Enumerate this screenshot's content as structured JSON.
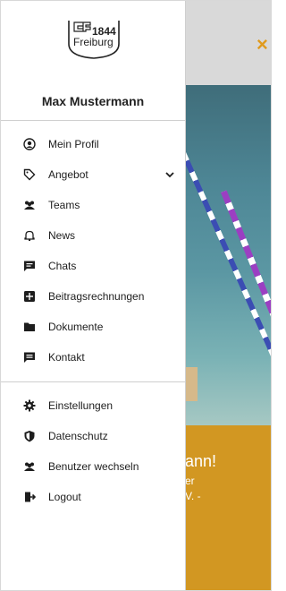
{
  "background": {
    "close_symbol": "×",
    "banner": {
      "line1": "ann!",
      "line2": "er",
      "line3": "V. -"
    }
  },
  "drawer": {
    "logo_text_year": "1844",
    "logo_text_city": "Freiburg",
    "user_name": "Max Mustermann",
    "menu": [
      {
        "label": "Mein Profil",
        "icon": "profile-icon"
      },
      {
        "label": "Angebot",
        "icon": "tag-icon",
        "expandable": true
      },
      {
        "label": "Teams",
        "icon": "team-icon"
      },
      {
        "label": "News",
        "icon": "bell-icon"
      },
      {
        "label": "Chats",
        "icon": "chat-icon"
      },
      {
        "label": "Beitragsrechnungen",
        "icon": "invoice-icon"
      },
      {
        "label": "Dokumente",
        "icon": "folder-icon"
      },
      {
        "label": "Kontakt",
        "icon": "contact-icon"
      }
    ],
    "secondary_menu": [
      {
        "label": "Einstellungen",
        "icon": "gear-icon"
      },
      {
        "label": "Datenschutz",
        "icon": "shield-icon"
      },
      {
        "label": "Benutzer wechseln",
        "icon": "switch-user-icon"
      },
      {
        "label": "Logout",
        "icon": "logout-icon"
      }
    ]
  },
  "colors": {
    "accent": "#e09a1c",
    "banner": "#d29722",
    "text": "#1d1d1d"
  }
}
